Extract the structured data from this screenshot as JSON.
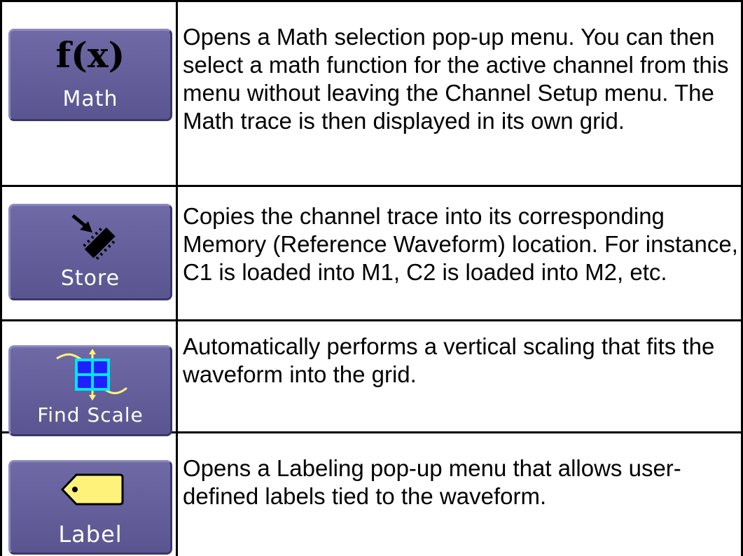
{
  "rows": [
    {
      "button_label": "Math",
      "icon_text": "f(x)",
      "icon": "fx-icon",
      "description": "Opens a Math selection pop-up menu.  You can then select a math function for the active channel  from this menu without leaving the Channel Setup menu. The Math trace is then displayed in its own grid."
    },
    {
      "button_label": "Store",
      "icon": "store-chip-arrow-icon",
      "description": "Copies the channel trace into its corresponding Memory (Reference Waveform) location.  For instance, C1 is loaded into M1, C2 is loaded into M2, etc."
    },
    {
      "button_label": "Find Scale",
      "icon": "find-scale-grid-icon",
      "description": "Automatically performs a vertical scaling that fits the waveform into the grid."
    },
    {
      "button_label": "Label",
      "icon": "tag-label-icon",
      "description": "Opens a Labeling pop-up menu that allows user-defined labels tied to the waveform."
    }
  ],
  "colors": {
    "button_face": "#6f6aa6",
    "icon_yellow": "#fff27a",
    "icon_cyan": "#00e5ff",
    "icon_blue": "#1f1fff"
  }
}
